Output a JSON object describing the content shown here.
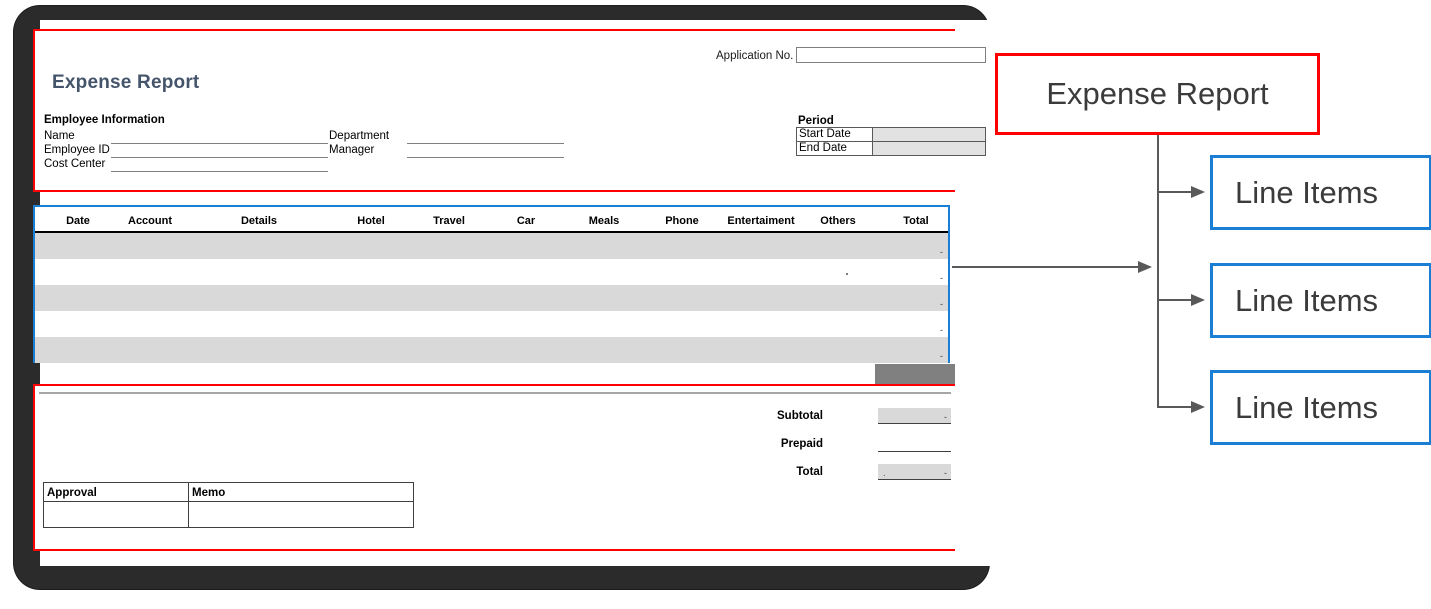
{
  "document": {
    "title": "Expense Report",
    "application_no_label": "Application No.",
    "application_no_value": "",
    "employee_information": {
      "heading": "Employee Information",
      "fields": [
        {
          "label": "Name",
          "value": ""
        },
        {
          "label": "Employee ID",
          "value": ""
        },
        {
          "label": "Cost Center",
          "value": ""
        },
        {
          "label": "Department",
          "value": ""
        },
        {
          "label": "Manager",
          "value": ""
        }
      ]
    },
    "period": {
      "heading": "Period",
      "rows": [
        {
          "label": "Start Date",
          "value": ""
        },
        {
          "label": "End Date",
          "value": ""
        }
      ]
    },
    "line_items": {
      "columns": [
        "Date",
        "Account",
        "Details",
        "Hotel",
        "Travel",
        "Car",
        "Meals",
        "Phone",
        "Entertaiment",
        "Others",
        "Total"
      ],
      "rows": [
        {
          "shaded": true,
          "total": "-"
        },
        {
          "shaded": false,
          "total": "-"
        },
        {
          "shaded": true,
          "total": "-"
        },
        {
          "shaded": false,
          "total": "-"
        },
        {
          "shaded": true,
          "total": "-"
        }
      ]
    },
    "totals": [
      {
        "label": "Subtotal",
        "value": "-",
        "filled": true
      },
      {
        "label": "Prepaid",
        "value": "",
        "filled": false
      },
      {
        "label": "Total",
        "value": "-",
        "filled": true
      }
    ],
    "approval": {
      "columns": [
        "Approval",
        "Memo"
      ],
      "row": {
        "approval": "",
        "memo": ""
      }
    }
  },
  "diagram": {
    "callouts": [
      {
        "label": "Expense Report",
        "color": "#ff0000"
      },
      {
        "label": "Line Items",
        "color": "#1a7fd4"
      },
      {
        "label": "Line Items",
        "color": "#1a7fd4"
      },
      {
        "label": "Line Items",
        "color": "#1a7fd4"
      }
    ]
  },
  "colors": {
    "red_border": "#ff0000",
    "blue_border": "#1a7fd4",
    "title_blue_gray": "#44546a",
    "row_shade": "#d9d9d9",
    "gray_block": "#808080",
    "connector": "#595959"
  }
}
